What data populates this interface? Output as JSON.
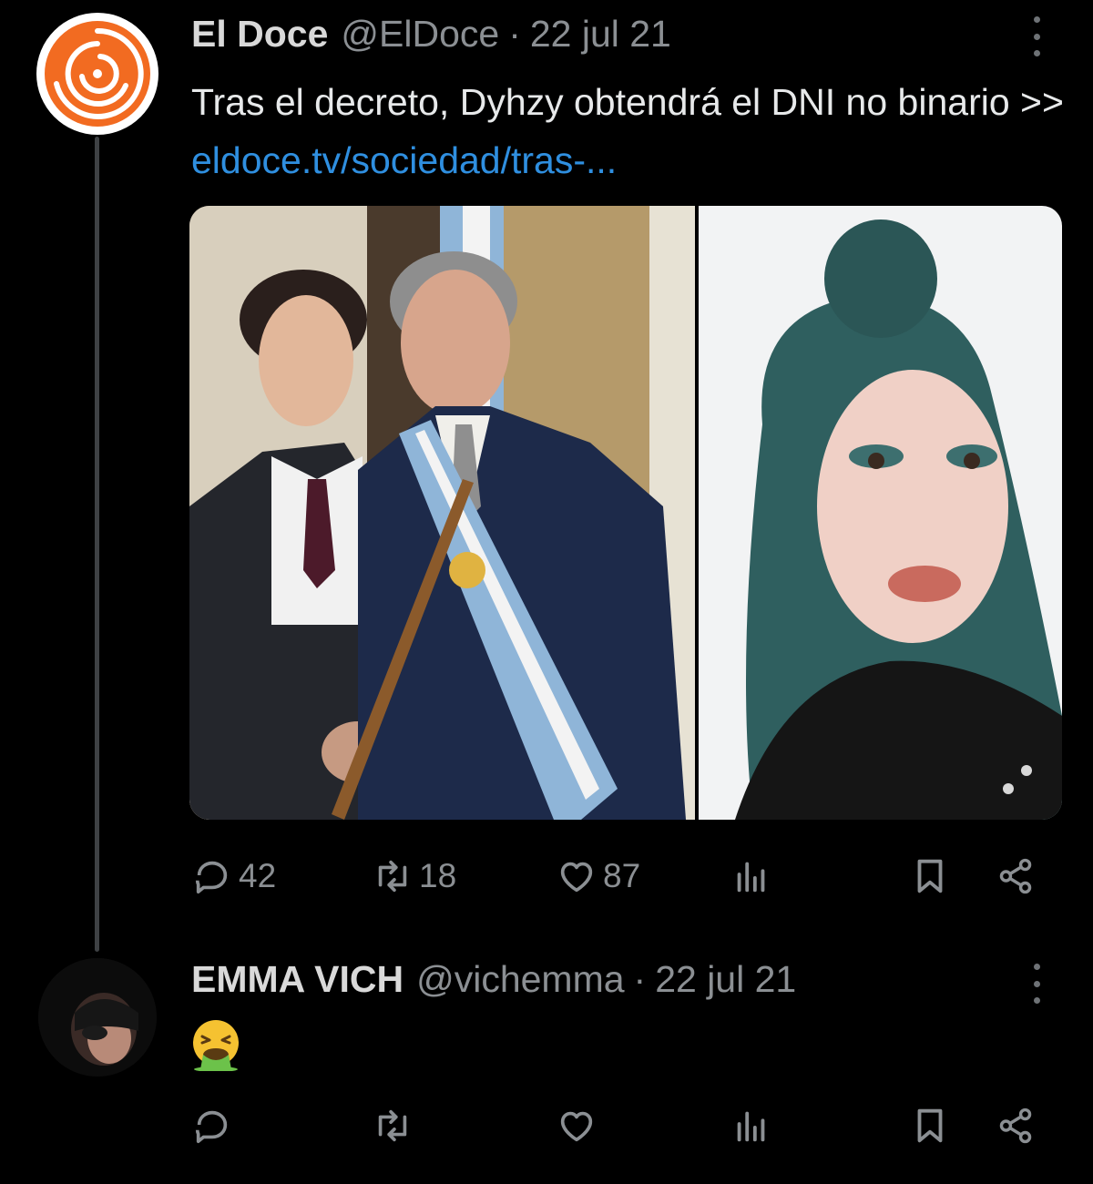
{
  "tweet": {
    "author_name": "El Doce",
    "handle": "@ElDoce",
    "separator": "·",
    "date": "22 jul 21",
    "text": "Tras el decreto, Dyhzy obtendrá el DNI no binario >> ",
    "link_text": "eldoce.tv/sociedad/tras-...",
    "stats": {
      "replies": "42",
      "retweets": "18",
      "likes": "87"
    }
  },
  "reply": {
    "author_name": "EMMA VICH",
    "handle": "@vichemma",
    "separator": "·",
    "date": "22 jul 21",
    "emoji": "nauseated-vomiting-face-emoji"
  },
  "colors": {
    "background": "#000000",
    "text": "#e7e9ea",
    "muted": "#8b8f93",
    "link": "#2f8fe0",
    "brand_orange": "#f26b21",
    "thread_line": "#3e4144"
  },
  "icons": [
    "reply-icon",
    "retweet-icon",
    "like-icon",
    "views-icon",
    "bookmark-icon",
    "share-icon",
    "more-icon"
  ]
}
